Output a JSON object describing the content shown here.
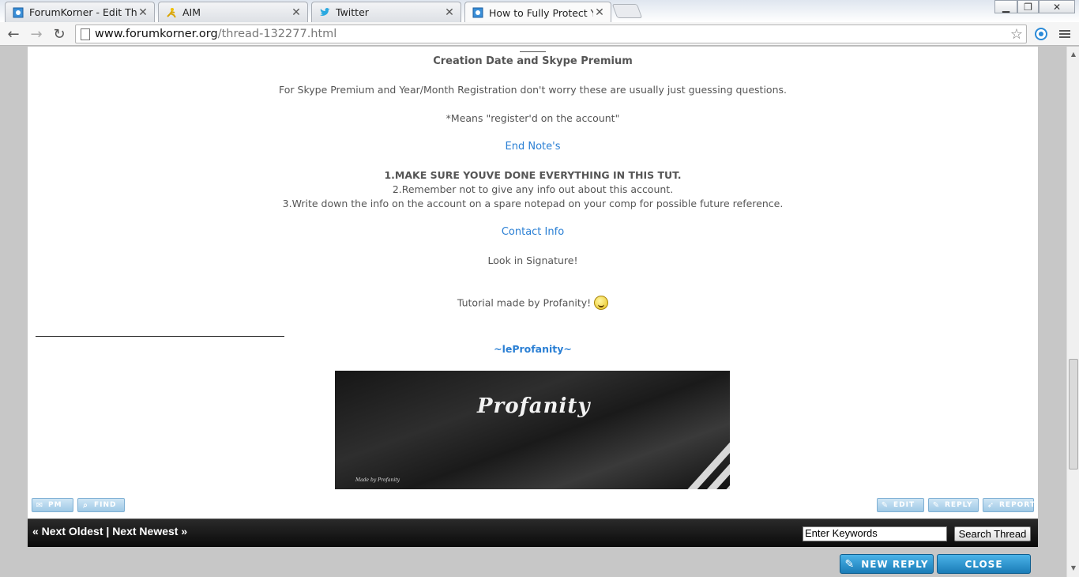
{
  "browser": {
    "tabs": [
      {
        "label": "ForumKorner - Edit This P",
        "icon": "forum-favicon"
      },
      {
        "label": "AIM",
        "icon": "aim-running-man-icon"
      },
      {
        "label": "Twitter",
        "icon": "twitter-bird-icon"
      },
      {
        "label": "How to Fully Protect Your",
        "icon": "forum-favicon"
      }
    ],
    "url_host": "www.forumkorner.org",
    "url_path": "/thread-132277.html"
  },
  "post": {
    "heading": "Creation Date and Skype Premium",
    "para1": "For Skype Premium and Year/Month Registration don't worry these are usually just guessing questions.",
    "para2": "*Means \"register'd on the account\"",
    "endnotes_title": "End Note's",
    "note1": "1.MAKE SURE YOUVE DONE EVERYTHING IN THIS TUT.",
    "note2": "2.Remember not to give any info out about this account.",
    "note3": "3.Write down the info on the account on a spare notepad on your comp for possible future reference.",
    "contact_title": "Contact Info",
    "contact_text": "Look in Signature!",
    "credit": "Tutorial made by Profanity!",
    "signature_name": "~leProfanity~",
    "banner_title": "Profanity",
    "banner_small": "Made by Profanity"
  },
  "post_buttons": {
    "pm": "PM",
    "find": "FIND",
    "edit": "EDIT",
    "reply": "REPLY",
    "report": "REPORT"
  },
  "thread_nav": {
    "prev": "« Next Oldest",
    "separator": "|",
    "next": "Next Newest »",
    "search_value": "Enter Keywords",
    "search_button": "Search Thread"
  },
  "actions": {
    "new_reply": "NEW REPLY",
    "close": "CLOSE"
  },
  "colors": {
    "link_blue": "#2a7fd4",
    "button_blue": "#1a7cb7"
  }
}
